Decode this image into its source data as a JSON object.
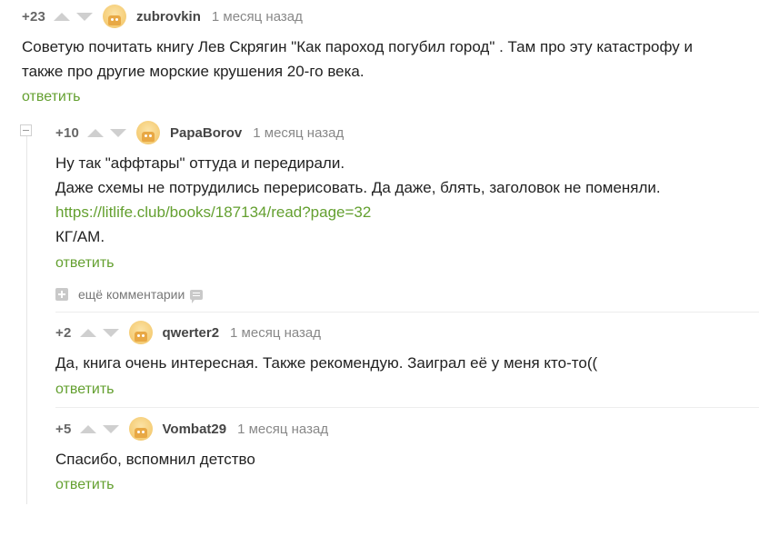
{
  "comments": [
    {
      "rating": "+23",
      "username": "zubrovkin",
      "time": "1 месяц назад",
      "lines": [
        "Советую почитать книгу Лев Скрягин \"Как пароход погубил город\" . Там про эту катастрофу и",
        "также про другие морские крушения 20-го века."
      ],
      "reply_label": "ответить"
    },
    {
      "rating": "+10",
      "username": "PapaBorov",
      "time": "1 месяц назад",
      "lines": [
        "Ну так \"аффтары\" оттуда и передирали.",
        "Даже схемы не потрудились перерисовать. Да даже, блять, заголовок не поменяли."
      ],
      "link": "https://litlife.club/books/187134/read?page=32",
      "after_link": "КГ/АМ.",
      "reply_label": "ответить"
    },
    {
      "rating": "+2",
      "username": "qwerter2",
      "time": "1 месяц назад",
      "lines": [
        "Да, книга очень интересная. Также рекомендую. Заиграл её у меня кто-то(("
      ],
      "reply_label": "ответить"
    },
    {
      "rating": "+5",
      "username": "Vombat29",
      "time": "1 месяц назад",
      "lines": [
        "Спасибо, вспомнил детство"
      ],
      "reply_label": "ответить"
    }
  ],
  "more_comments_label": "ещё комментарии",
  "icons": {
    "upvote": "arrow-up-icon",
    "downvote": "arrow-down-icon",
    "collapse": "minus-square-icon",
    "expand": "plus-square-icon",
    "comment": "comment-bubble-icon"
  },
  "colors": {
    "link": "#64a030",
    "meta": "#888888",
    "vote": "#cfcfcf",
    "avatar": "#f6cf7b"
  }
}
